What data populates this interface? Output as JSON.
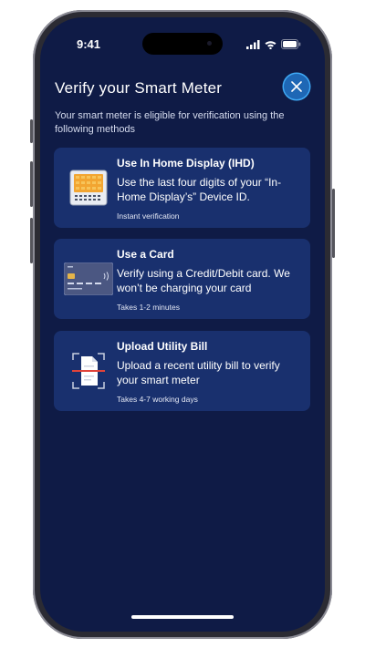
{
  "status_bar": {
    "time": "9:41",
    "icons": [
      "signal-icon",
      "wifi-icon",
      "battery-icon"
    ]
  },
  "header": {
    "title": "Verify your Smart Meter",
    "close_icon": "close-icon",
    "subtitle": "Your smart meter is eligible for verification using the following methods"
  },
  "methods": [
    {
      "title": "Use In Home Display (IHD)",
      "description": "Use the last four digits of your “In-Home Display’s” Device ID.",
      "note": "Instant verification",
      "icon": "in-home-display-icon"
    },
    {
      "title": "Use a Card",
      "description": "Verify using a Credit/Debit card. We won’t be charging your card",
      "note": "Takes 1-2 minutes",
      "icon": "credit-card-icon"
    },
    {
      "title": "Upload Utility Bill",
      "description": "Upload a recent utility bill to verify your smart meter",
      "note": "Takes 4-7 working days",
      "icon": "document-scan-icon"
    }
  ],
  "colors": {
    "background": "#0f1b46",
    "card": "#19306e",
    "accent": "#1e67b5",
    "accent_border": "#3fa9f5"
  }
}
